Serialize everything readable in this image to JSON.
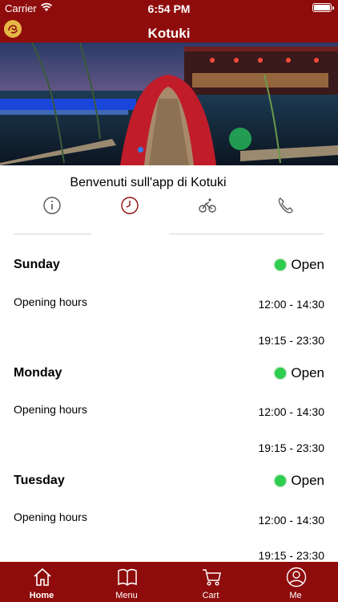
{
  "status": {
    "carrier": "Carrier",
    "time": "6:54 PM"
  },
  "header": {
    "title": "Kotuki"
  },
  "welcome": "Benvenuti sull'app di Kotuki",
  "info_tabs": [
    {
      "name": "info",
      "icon": "info-circle-icon",
      "active": false
    },
    {
      "name": "hours",
      "icon": "clock-icon",
      "active": true
    },
    {
      "name": "delivery",
      "icon": "bicycle-icon",
      "active": false
    },
    {
      "name": "phone",
      "icon": "phone-icon",
      "active": false
    }
  ],
  "days": [
    {
      "day": "Sunday",
      "status": "Open",
      "label": "Opening hours",
      "slots": [
        "12:00 - 14:30",
        "19:15 - 23:30"
      ]
    },
    {
      "day": "Monday",
      "status": "Open",
      "label": "Opening hours",
      "slots": [
        "12:00 - 14:30",
        "19:15 - 23:30"
      ]
    },
    {
      "day": "Tuesday",
      "status": "Open",
      "label": "Opening hours",
      "slots": [
        "12:00 - 14:30",
        "19:15 - 23:30"
      ]
    }
  ],
  "tabbar": [
    {
      "label": "Home",
      "icon": "home-icon",
      "active": true
    },
    {
      "label": "Menu",
      "icon": "book-icon",
      "active": false
    },
    {
      "label": "Cart",
      "icon": "cart-icon",
      "active": false
    },
    {
      "label": "Me",
      "icon": "user-icon",
      "active": false
    }
  ],
  "colors": {
    "brand": "#8f0c0c",
    "open": "#2ecc4f",
    "active_tab": "#8f0c0c"
  }
}
